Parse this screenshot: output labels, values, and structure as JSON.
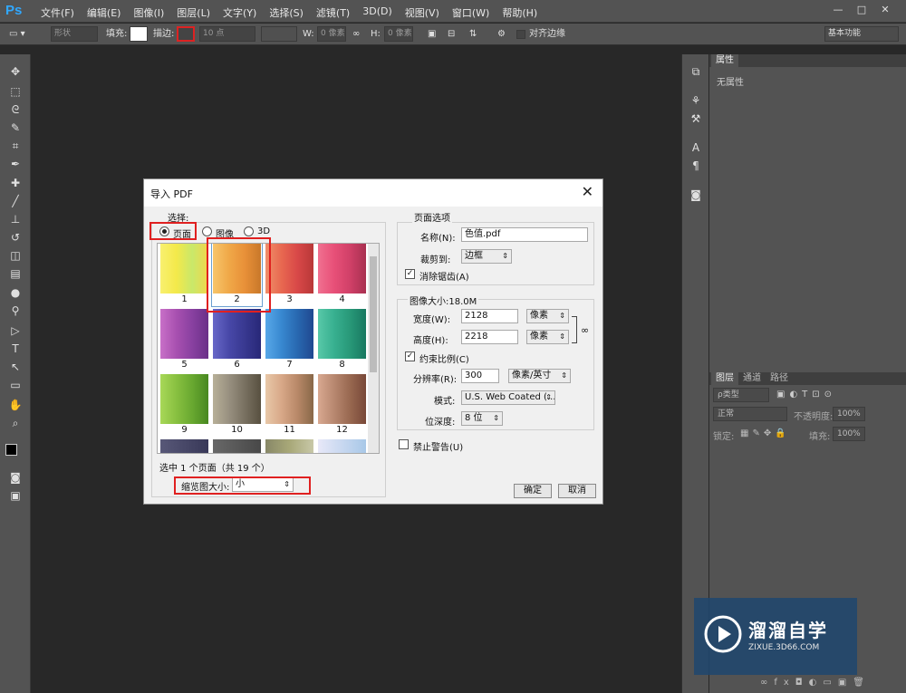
{
  "app": {
    "logo": "Ps"
  },
  "menu": [
    "文件(F)",
    "编辑(E)",
    "图像(I)",
    "图层(L)",
    "文字(Y)",
    "选择(S)",
    "滤镜(T)",
    "3D(D)",
    "视图(V)",
    "窗口(W)",
    "帮助(H)"
  ],
  "window_controls": {
    "minimize": "—",
    "restore": "□",
    "close": "✕"
  },
  "options": {
    "shape_mode": "形状",
    "fill_label": "填充:",
    "stroke_label": "描边:",
    "stroke_size": "10 点",
    "w_label": "W:",
    "w_value": "0 像素",
    "h_label": "H:",
    "h_value": "0 像素",
    "align_edges": "对齐边缘",
    "workspace": "基本功能"
  },
  "panels": {
    "properties_tab": "属性",
    "no_properties": "无属性",
    "layers_tabs": [
      "图层",
      "通道",
      "路径"
    ],
    "kind_filter": "ρ类型",
    "blend_mode": "正常",
    "opacity_label": "不透明度:",
    "opacity_value": "100%",
    "lock_label": "锁定:",
    "fill_label": "填充:",
    "fill_value": "100%"
  },
  "dialog": {
    "title": "导入 PDF",
    "select_label": "选择:",
    "radio_page": "页面",
    "radio_image": "图像",
    "radio_3d": "3D",
    "thumbnails": [
      "1",
      "2",
      "3",
      "4",
      "5",
      "6",
      "7",
      "8",
      "9",
      "10",
      "11",
      "12"
    ],
    "selected_text": "选中 1 个页面（共 19 个）",
    "thumb_size_label": "缩览图大小:",
    "thumb_size_value": "小",
    "page_options_label": "页面选项",
    "name_label": "名称(N):",
    "name_value": "色值.pdf",
    "crop_label": "裁剪到:",
    "crop_value": "边框",
    "antialias_label": "消除锯齿(A)",
    "image_size_label": "图像大小:18.0M",
    "width_label": "宽度(W):",
    "width_value": "2128",
    "width_unit": "像素",
    "height_label": "高度(H):",
    "height_value": "2218",
    "height_unit": "像素",
    "constrain_label": "约束比例(C)",
    "resolution_label": "分辨率(R):",
    "resolution_value": "300",
    "resolution_unit": "像素/英寸",
    "mode_label": "模式:",
    "mode_value": "U.S. Web Coated (...",
    "bitdepth_label": "位深度:",
    "bitdepth_value": "8 位",
    "suppress_label": "禁止警告(U)",
    "ok": "确定",
    "cancel": "取消"
  },
  "watermark": {
    "brand": "溜溜自学",
    "url": "ZIXUE.3D66.COM"
  }
}
